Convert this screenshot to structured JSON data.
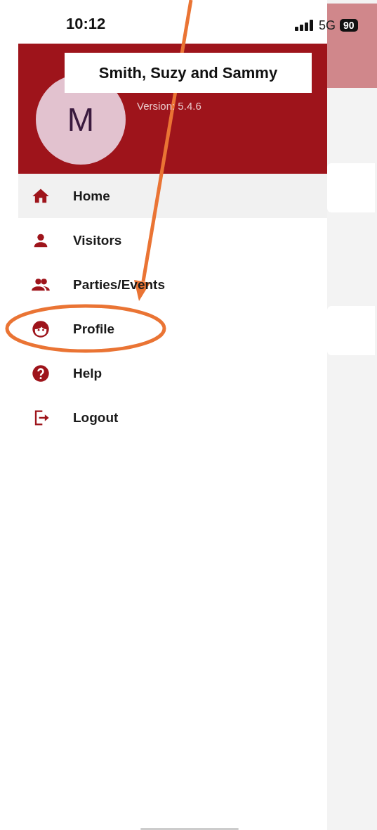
{
  "status_bar": {
    "time": "10:12",
    "network": "5G",
    "battery": "90"
  },
  "drawer": {
    "header": {
      "avatar_initial": "M",
      "name": "Smith, Suzy and Sammy",
      "version": "Version: 5.4.6"
    },
    "items": [
      {
        "kind": "home",
        "label": "Home",
        "selected": true
      },
      {
        "kind": "person",
        "label": "Visitors",
        "selected": false
      },
      {
        "kind": "group",
        "label": "Parties/Events",
        "selected": false
      },
      {
        "kind": "face",
        "label": "Profile",
        "selected": false
      },
      {
        "kind": "help",
        "label": "Help",
        "selected": false
      },
      {
        "kind": "logout",
        "label": "Logout",
        "selected": false
      }
    ]
  }
}
